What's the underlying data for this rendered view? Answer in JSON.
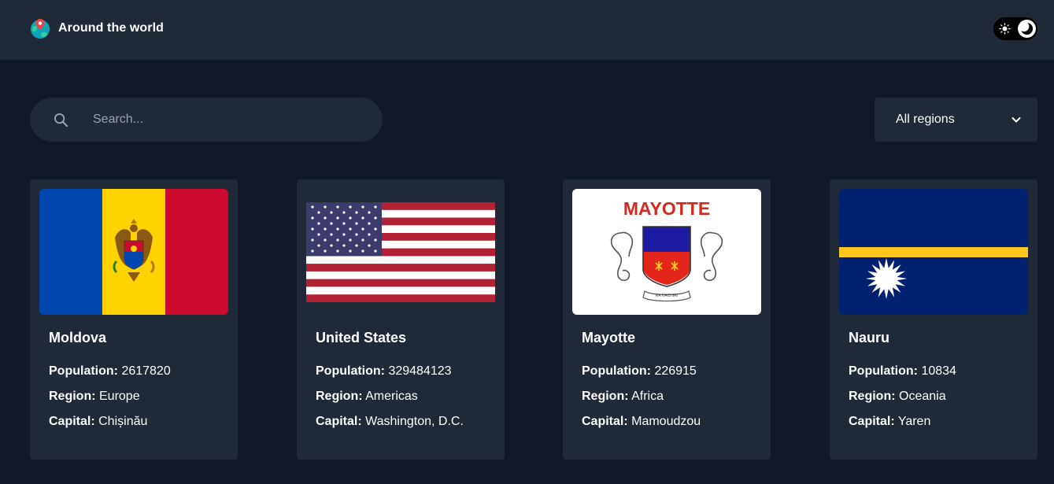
{
  "header": {
    "title": "Around the world",
    "logo_icon": "globe-pin-icon",
    "theme_toggle": {
      "sun_icon": "sun-icon",
      "moon_icon": "moon-icon",
      "mode": "dark"
    }
  },
  "search": {
    "placeholder": "Search...",
    "value": "",
    "icon": "search-icon"
  },
  "region_filter": {
    "label": "All regions",
    "icon": "chevron-down-icon"
  },
  "labels": {
    "population": "Population:",
    "region": "Region:",
    "capital": "Capital:"
  },
  "countries": [
    {
      "name": "Moldova",
      "population": "2617820",
      "region": "Europe",
      "capital": "Chișinău",
      "flag": "moldova-flag"
    },
    {
      "name": "United States",
      "population": "329484123",
      "region": "Americas",
      "capital": "Washington, D.C.",
      "flag": "usa-flag"
    },
    {
      "name": "Mayotte",
      "population": "226915",
      "region": "Africa",
      "capital": "Mamoudzou",
      "flag": "mayotte-flag",
      "flag_text": "MAYOTTE",
      "flag_motto": "RA HACHIRI"
    },
    {
      "name": "Nauru",
      "population": "10834",
      "region": "Oceania",
      "capital": "Yaren",
      "flag": "nauru-flag"
    }
  ],
  "colors": {
    "background": "#111827",
    "surface": "#1f2937",
    "text": "#ffffff",
    "placeholder": "#9ca3af"
  }
}
